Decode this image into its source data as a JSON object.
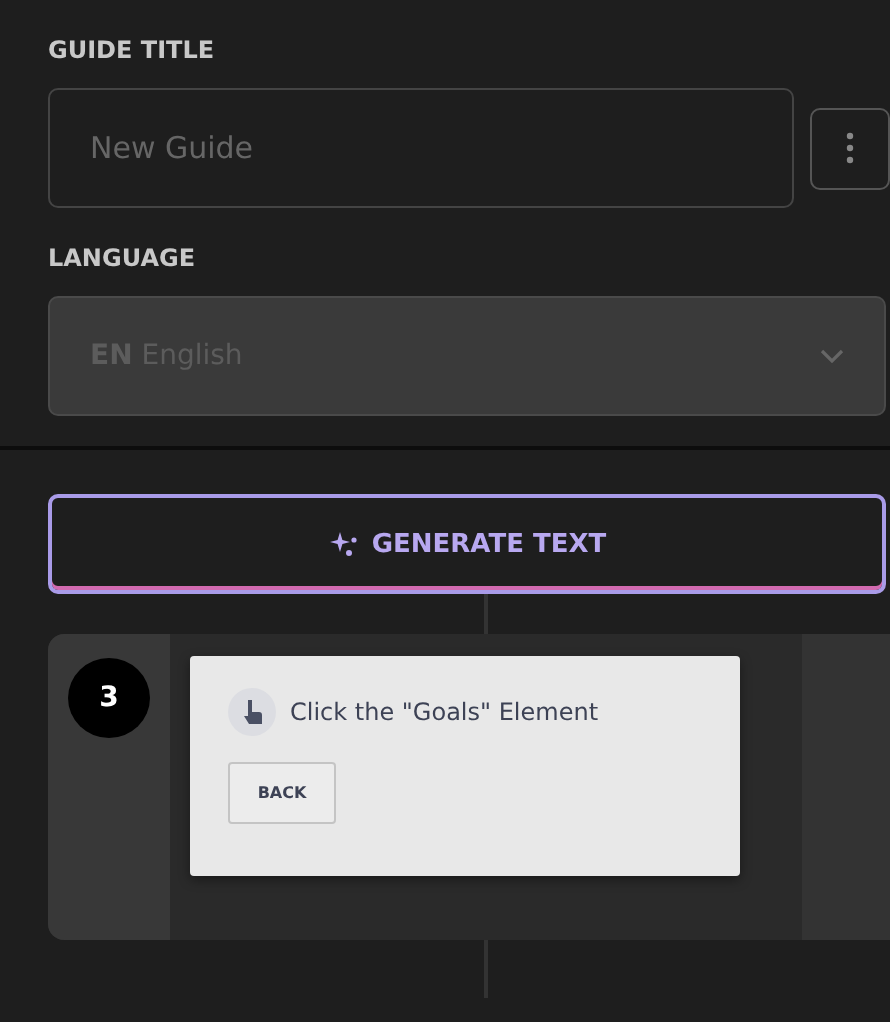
{
  "guide_title": {
    "label": "GUIDE TITLE",
    "placeholder": "New Guide"
  },
  "language": {
    "label": "LANGUAGE",
    "code": "EN",
    "name": "English",
    "disabled": true
  },
  "generate_button": {
    "label": "GENERATE TEXT"
  },
  "step": {
    "number": "3",
    "text": "Click the \"Goals\" Element",
    "back_button": "BACK"
  }
}
